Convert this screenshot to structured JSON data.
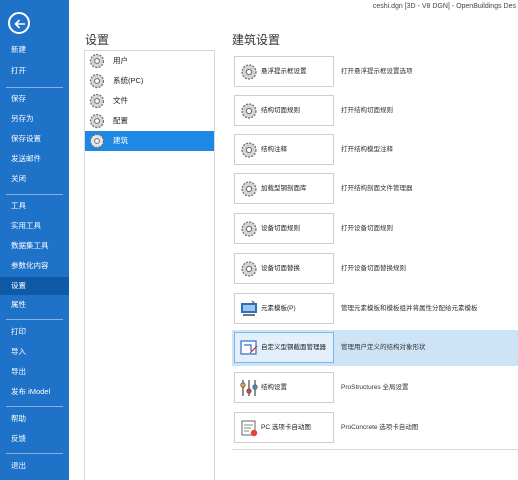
{
  "titlebar": {
    "text": "ceshi.dgn [3D - V8 DGN] - OpenBuildings Des"
  },
  "nav": {
    "back_icon": "back-arrow-icon",
    "items": [
      {
        "label": "新建"
      },
      {
        "label": "打开"
      },
      {
        "label": "保存"
      },
      {
        "label": "另存为"
      },
      {
        "label": "保存设置"
      },
      {
        "label": "发送邮件"
      },
      {
        "label": "关闭"
      },
      {
        "label": "工具"
      },
      {
        "label": "实用工具"
      },
      {
        "label": "数据集工具"
      },
      {
        "label": "参数化内容"
      },
      {
        "label": "设置"
      },
      {
        "label": "属性"
      },
      {
        "label": "打印"
      },
      {
        "label": "导入"
      },
      {
        "label": "导出"
      },
      {
        "label": "发布 iModel"
      },
      {
        "label": "帮助"
      },
      {
        "label": "反馈"
      },
      {
        "label": "退出"
      }
    ],
    "selected": "设置"
  },
  "settings": {
    "heading": "设置",
    "items": [
      {
        "label": "用户",
        "icon": "gear-icon"
      },
      {
        "label": "系统(PC)",
        "icon": "gear-icon"
      },
      {
        "label": "文件",
        "icon": "gear-icon"
      },
      {
        "label": "配置",
        "icon": "gear-icon"
      },
      {
        "label": "建筑",
        "icon": "gear-icon"
      }
    ],
    "selected": "建筑"
  },
  "architecture": {
    "heading": "建筑设置",
    "rows": [
      {
        "button": "悬浮提示框设置",
        "desc": "打开悬浮提示框设置选项",
        "icon": "gear-icon"
      },
      {
        "button": "结构切面规则",
        "desc": "打开结构切面规则",
        "icon": "gear-icon"
      },
      {
        "button": "结构注释",
        "desc": "打开结构模型注释",
        "icon": "gear-icon"
      },
      {
        "button": "加载型钢剖面库",
        "desc": "打开结构剖面文件管理器",
        "icon": "gear-icon"
      },
      {
        "button": "设备切面规则",
        "desc": "打开设备切面规则",
        "icon": "gear-icon"
      },
      {
        "button": "设备切面替换",
        "desc": "打开设备切面替换规则",
        "icon": "gear-icon"
      },
      {
        "button": "元素模板(P)",
        "desc": "管理元素模板和模板组并将属性分配给元素模板",
        "icon": "element-template-icon"
      },
      {
        "button": "自定义型钢截面管理器",
        "desc": "管理用户定义的结构对象形状",
        "icon": "custom-section-icon"
      },
      {
        "button": "结构设置",
        "desc": "ProStructures 全局设置",
        "icon": "sliders-icon"
      },
      {
        "button": "PC 选项卡自动图",
        "desc": "ProConcrete 选项卡自动图",
        "icon": "pc-options-icon"
      }
    ],
    "selected_row": 7
  }
}
